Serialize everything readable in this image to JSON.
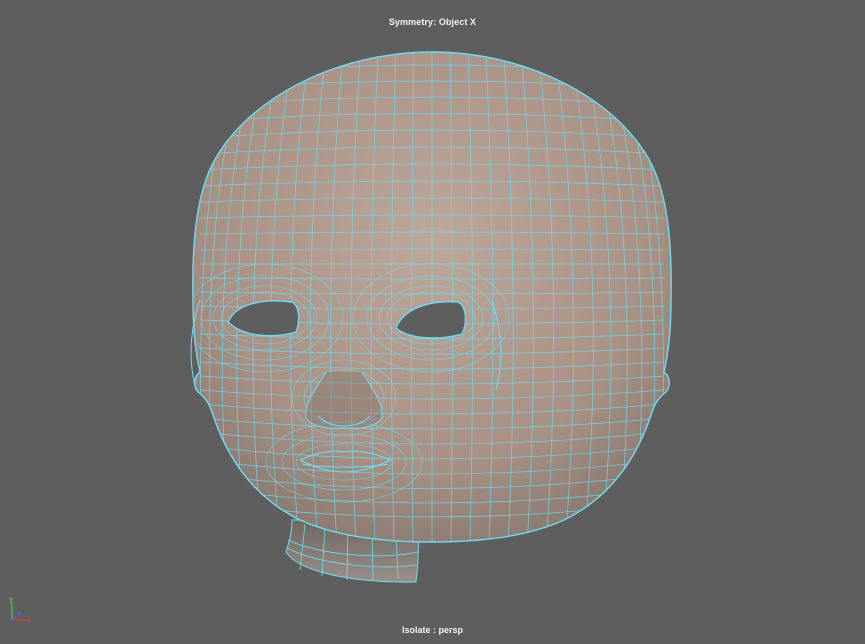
{
  "viewport": {
    "camera_name": "persp",
    "symmetry_hud": "Symmetry: Object X",
    "isolate_hud": "Isolate : persp",
    "background_color": "#5e5e5e"
  },
  "model": {
    "object": "head",
    "display": "wireframe-on-shaded",
    "shade_color": "#b09a8d",
    "wire_color": "#6fdcf2"
  },
  "axis_gizmo": {
    "x_label": "x",
    "y_label": "y",
    "z_label": "z",
    "x_color": "#e04040",
    "y_color": "#3fd04f",
    "z_color": "#4a6bf0"
  }
}
